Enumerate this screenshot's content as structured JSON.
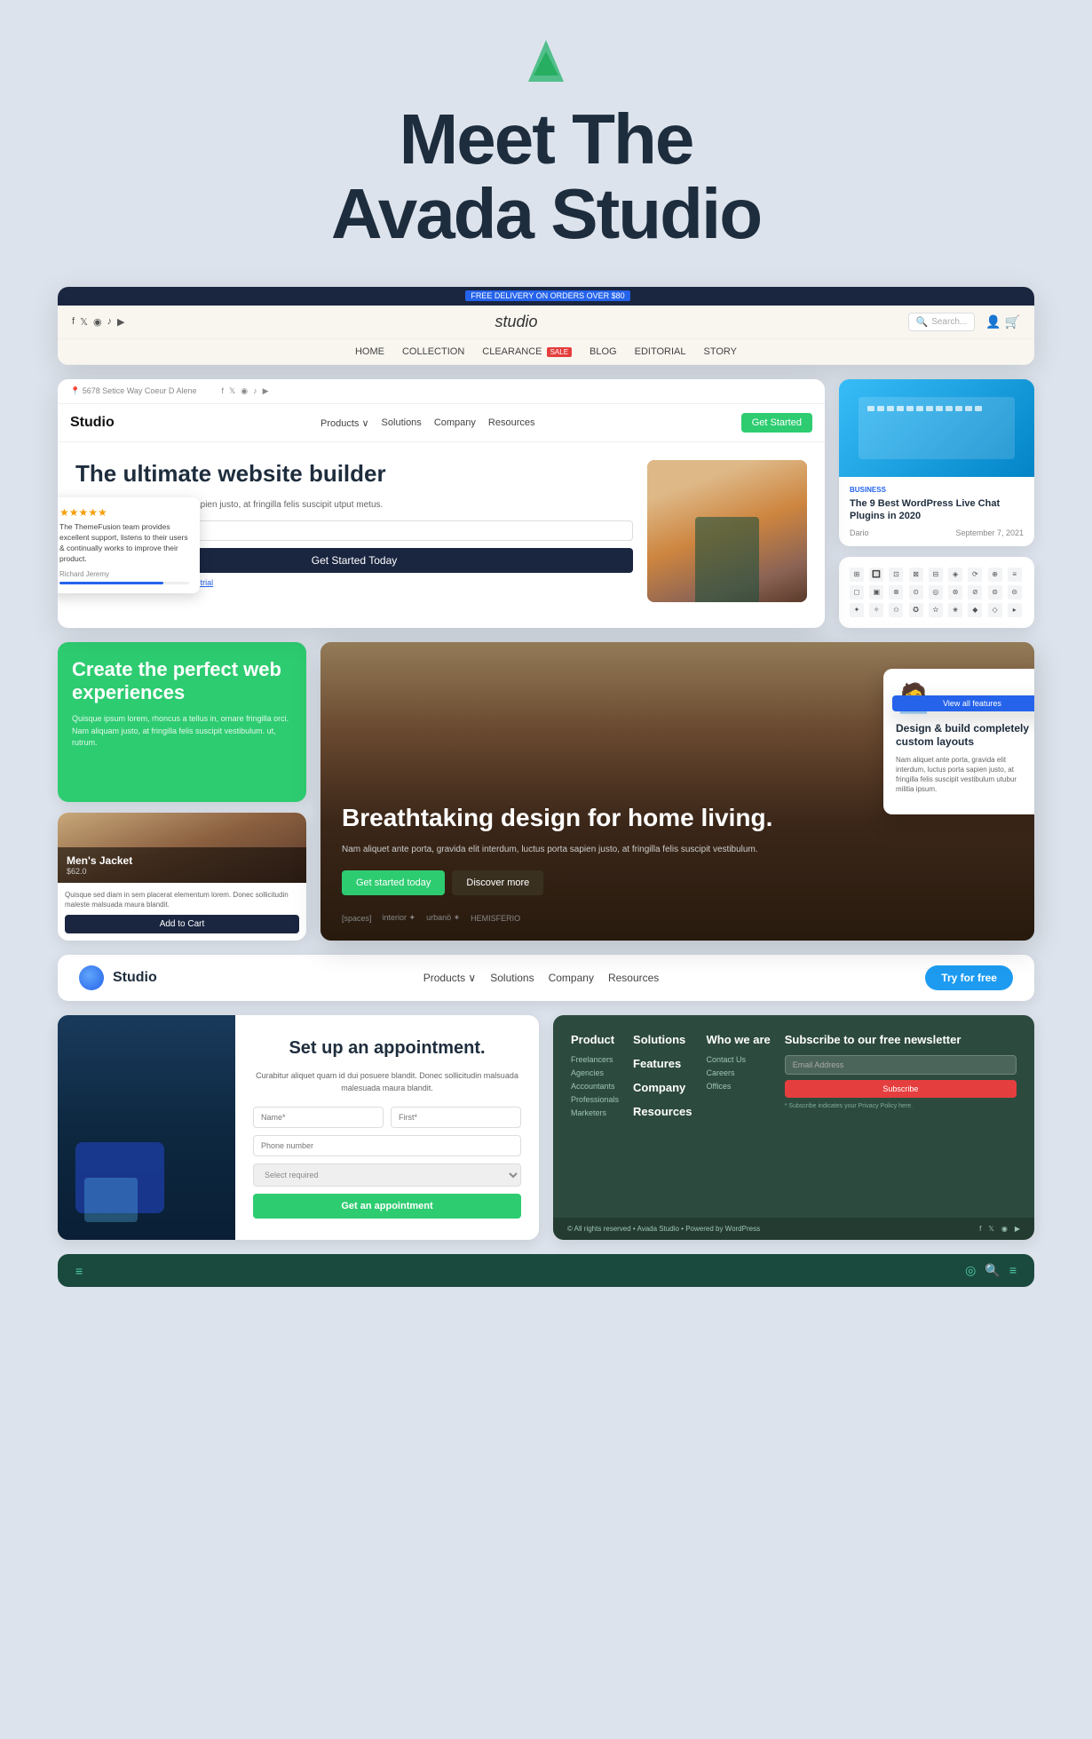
{
  "page": {
    "bg_color": "#dde3ec",
    "logo_symbol": "▲",
    "main_title_line1": "Meet The",
    "main_title_line2": "Avada Studio"
  },
  "top_browser": {
    "delivery_bar": "FREE DELIVERY ON ORDERS OVER $80",
    "delivery_badge": "SALE",
    "site_name": "studio",
    "search_placeholder": "Search...",
    "nav_links": [
      "HOME",
      "COLLECTION",
      "CLEARANCE",
      "BLOG",
      "EDITORIAL",
      "STORY"
    ],
    "clearance_badge": "SALE"
  },
  "demo_card": {
    "address": "5678 Setice Way Coeur D Alene",
    "logo": "Studio",
    "nav_links": [
      "Products ∨",
      "Solutions",
      "Company",
      "Resources"
    ],
    "cta": "Get Started",
    "hero_title": "The ultimate website builder",
    "hero_body": "te porta, gravida elit interdum, apien justo, at fringilla felis suscipit utput metus.",
    "email_placeholder": "l address",
    "get_started_btn": "Get Started Today",
    "trial_link": "yet? Get started with a 12-day free trial"
  },
  "review_card": {
    "stars": "★★★★★",
    "text": "The ThemeFusion team provides excellent support, listens to their users & continually works to improve their product.",
    "author": "Richard Jeremy"
  },
  "blog_card": {
    "category": "Business",
    "title": "The 9 Best WordPress Live Chat Plugins in 2020",
    "author": "Dario",
    "date": "September 7, 2021"
  },
  "green_section": {
    "title": "Create the perfect web experiences",
    "body": "Quisque ipsum lorem, rhoncus a tellus in, ornare fringilla orci. Nam aliquam justo, at fringilla felis suscipit vestibulum. ut, rutrum."
  },
  "product_card": {
    "title": "Men's Jacket",
    "price": "$62.0",
    "description": "Quisque sed diam in sem placerat elementum lorem. Donec sollicitudin maleste malsuada maura blandit.",
    "btn_label": "Add to Cart"
  },
  "dark_hero": {
    "title": "Breathtaking design for home living.",
    "body": "Nam aliquet ante porta, gravida elit interdum, luctus porta sapien justo, at fringilla felis suscipit vestibulum.",
    "btn1": "Get started today",
    "btn2": "Discover more",
    "brands": [
      "[spaces]",
      "interior ✦",
      "urbanö ✶",
      "HEMISFERIO"
    ]
  },
  "design_build_card": {
    "title": "Design & build completely custom layouts",
    "body": "Nam aliquet ante porta, gravida elit interdum, luctus porta sapien justo, at fringilla felis suscipit vestibulum utubur militia ipsum.",
    "btn_label": "View all features"
  },
  "navbar": {
    "brand": "Studio",
    "links": [
      "Products ∨",
      "Solutions",
      "Company",
      "Resources"
    ],
    "cta": "Try for free"
  },
  "appt_card": {
    "title": "Set up an appointment.",
    "body": "Curabitur aliquet quam id dui posuere blandit. Donec sollicitudin malsuada malesuada maura blandit.",
    "name_placeholder": "Name*",
    "first_name_placeholder": "First*",
    "phone_placeholder": "Phone number",
    "select_placeholder": "Select required",
    "submit_btn": "Get an appointment"
  },
  "footer_card": {
    "cols": [
      {
        "title": "Product",
        "links": [
          "Freelancers",
          "Agencies",
          "Accountants",
          "Professionals",
          "Marketers"
        ]
      },
      {
        "title": "Solutions",
        "links": []
      },
      {
        "title": "Features",
        "links": []
      },
      {
        "title": "Company",
        "links": []
      },
      {
        "title": "Resources",
        "links": []
      }
    ],
    "who_we_are_title": "Who we are",
    "who_links": [
      "Contact Us",
      "Careers",
      "Offices"
    ],
    "newsletter_title": "Subscribe to our free newsletter",
    "email_placeholder": "Email Address",
    "subscribe_btn": "Subscribe",
    "copyright": "© All rights reserved • Avada Studio • Powered by WordPress"
  },
  "teal_bar": {
    "icon1": "≡",
    "icon2": "◎",
    "icon3": "🔍",
    "icon4": "≡"
  }
}
